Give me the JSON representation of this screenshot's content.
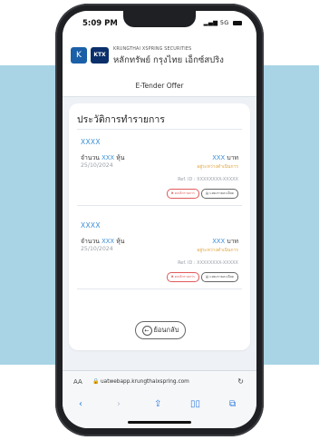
{
  "status_bar": {
    "time": "5:09 PM",
    "signal": "5G"
  },
  "brand": {
    "logo_mark": "K",
    "logo_ktx": "KTX",
    "name_en": "KRUNGTHAI XSPRING SECURITIES",
    "name_th": "หลักทรัพย์ กรุงไทย เอ็กซ์สปริง"
  },
  "page": {
    "header": "E-Tender Offer",
    "title": "ประวัติการทำรายการ"
  },
  "transactions": [
    {
      "code": "XXXX",
      "qty_prefix": "จำนวน",
      "qty_value": "XXX",
      "qty_unit": "หุ้น",
      "amount_value": "XXX",
      "amount_unit": "บาท",
      "date": "25/10/2024",
      "status": "อยู่ระหว่างดำเนินการ",
      "ref": "Ref. ID : XXXXXXXX-XXXXX",
      "cancel_label": "ยกเลิกรายการ",
      "detail_label": "แสดงรายละเอียด"
    },
    {
      "code": "XXXX",
      "qty_prefix": "จำนวน",
      "qty_value": "XXX",
      "qty_unit": "หุ้น",
      "amount_value": "XXX",
      "amount_unit": "บาท",
      "date": "25/10/2024",
      "status": "อยู่ระหว่างดำเนินการ",
      "ref": "Ref. ID : XXXXXXXX-XXXXX",
      "cancel_label": "ยกเลิกรายการ",
      "detail_label": "แสดงรายละเอียด"
    }
  ],
  "back_button": {
    "label": "ย้อนกลับ",
    "icon": "back-arrow-icon"
  },
  "browser": {
    "aa": "AA",
    "url": "uatwebapp.krungthaixspring.com",
    "icons": [
      "lock-icon",
      "reload-icon",
      "back-icon",
      "forward-icon",
      "share-icon",
      "bookmarks-icon",
      "tabs-icon"
    ]
  },
  "colors": {
    "accent": "#3b8fd8",
    "status_pending": "#e0a23a",
    "cancel": "#e05a5a",
    "backdrop": "#a9d4e6",
    "frame": "#1f2024"
  }
}
